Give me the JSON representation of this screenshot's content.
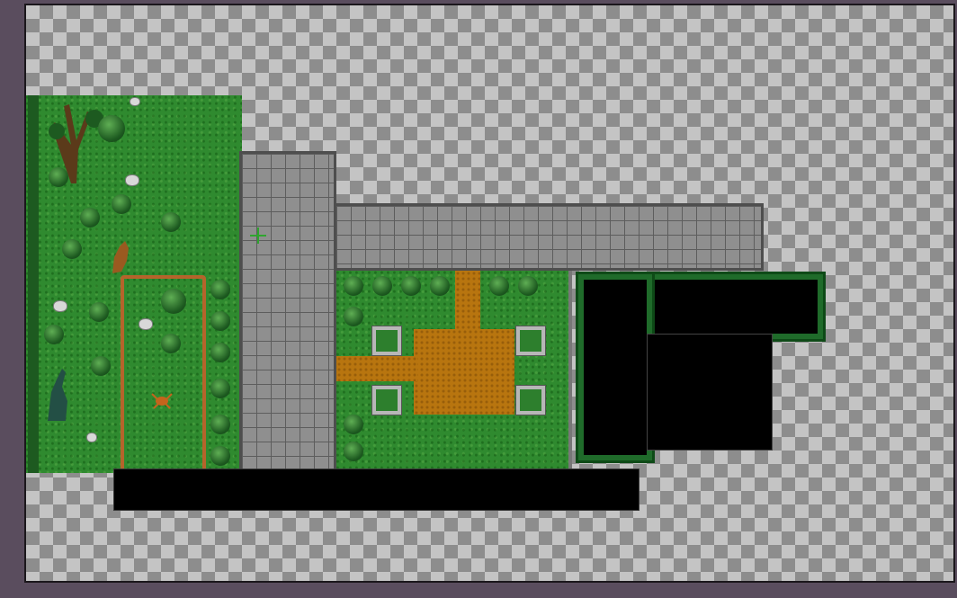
{
  "editor": {
    "frame_bg": "#5a4d5e",
    "transparency_checker": [
      "#c4c4c4",
      "#8d8d8d"
    ]
  },
  "map": {
    "palette": {
      "grass": "#2f8a2f",
      "stone": "#8f8f8f",
      "dirt": "#b8750f",
      "void": "#000000",
      "hedge": "#1f6b2a"
    },
    "layers": [
      {
        "name": "grass-area-west",
        "tile": "grass"
      },
      {
        "name": "stone-path-vertical",
        "tile": "stone"
      },
      {
        "name": "stone-path-horizontal",
        "tile": "stone"
      },
      {
        "name": "garden-courtyard",
        "tile": "grass"
      },
      {
        "name": "dirt-plaza",
        "tile": "dirt"
      },
      {
        "name": "hedged-void-area",
        "tile": "void"
      },
      {
        "name": "bottom-void-strip",
        "tile": "void"
      }
    ],
    "icons": [
      "tree-icon",
      "bush-icon",
      "rock-icon",
      "planter-icon",
      "crosshair-icon",
      "statue-icon"
    ]
  }
}
